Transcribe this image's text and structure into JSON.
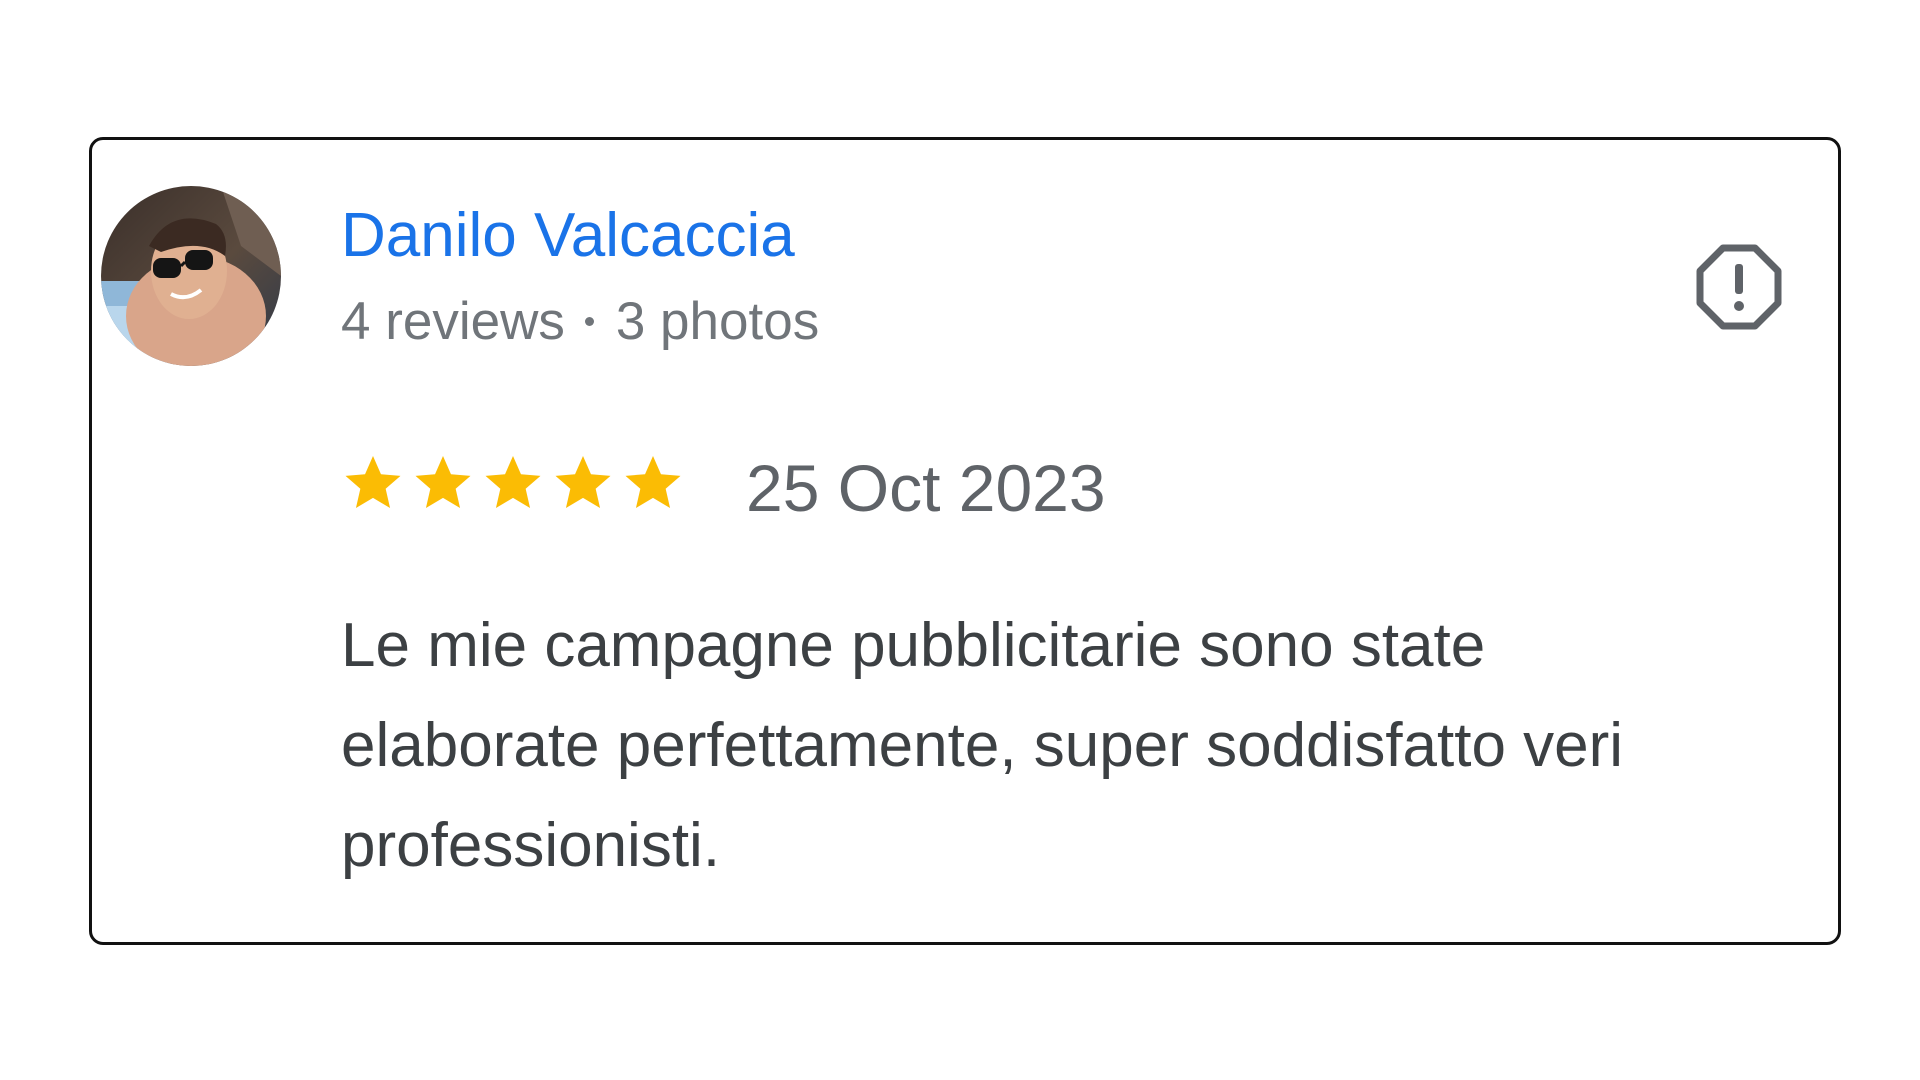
{
  "review": {
    "author_name": "Danilo Valcaccia",
    "reviews_count": "4 reviews",
    "photos_count": "3 photos",
    "rating": 5,
    "rating_max": 5,
    "date": "25 Oct 2023",
    "text_lines": [
      "Le mie campagne pubblicitarie sono state",
      "elaborate perfettamente, super soddisfatto veri",
      "professionisti."
    ]
  },
  "icons": {
    "report": "report-flag-octagon-icon",
    "star": "star-icon"
  },
  "colors": {
    "name": "#1a73e8",
    "star": "#fbbc04",
    "meta": "#70757a",
    "text": "#3c4043"
  }
}
